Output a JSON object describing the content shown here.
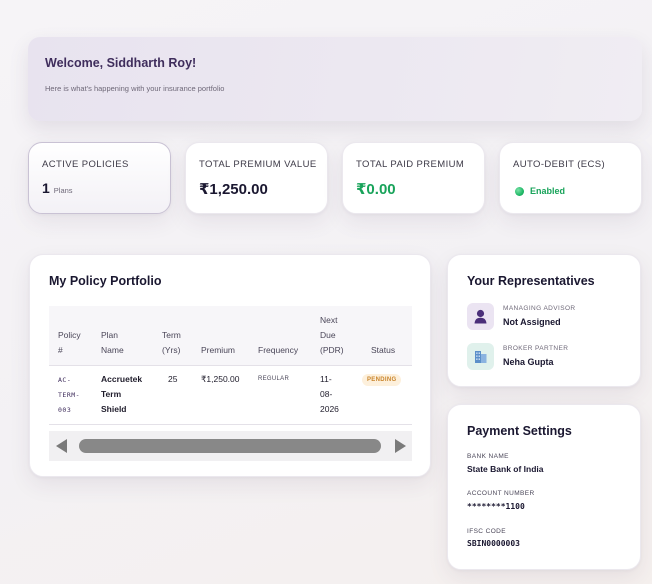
{
  "welcome": {
    "title": "Welcome, Siddharth Roy!",
    "subtitle": "Here is what's happening with your insurance portfolio"
  },
  "stats": {
    "active_policies": {
      "label": "ACTIVE POLICIES",
      "value": "1",
      "unit": "Plans"
    },
    "total_premium": {
      "label": "TOTAL PREMIUM VALUE",
      "value": "₹1,250.00"
    },
    "total_paid": {
      "label": "TOTAL PAID PREMIUM",
      "value": "₹0.00"
    },
    "auto_debit": {
      "label": "AUTO-DEBIT (ECS)",
      "status": "Enabled"
    }
  },
  "portfolio": {
    "title": "My Policy Portfolio",
    "columns": {
      "policy_no": [
        "Policy",
        "#"
      ],
      "plan_name": [
        "Plan",
        "Name"
      ],
      "term": [
        "Term",
        "(Yrs)"
      ],
      "premium": "Premium",
      "frequency": "Frequency",
      "next_due": [
        "Next",
        "Due",
        "(PDR)"
      ],
      "status": "Status"
    },
    "rows": [
      {
        "policy_no": [
          "AC-",
          "TERM-",
          "003"
        ],
        "plan_name": [
          "Accruetek",
          "Term",
          "Shield"
        ],
        "term": "25",
        "premium": "₹1,250.00",
        "frequency": "REGULAR",
        "next_due": [
          "11-",
          "08-",
          "2026"
        ],
        "status": "PENDING"
      }
    ]
  },
  "representatives": {
    "title": "Your Representatives",
    "items": [
      {
        "role": "MANAGING ADVISOR",
        "name": "Not Assigned",
        "icon": "person-icon"
      },
      {
        "role": "BROKER PARTNER",
        "name": "Neha Gupta",
        "icon": "building-icon"
      }
    ]
  },
  "payment": {
    "title": "Payment Settings",
    "bank_name_label": "BANK NAME",
    "bank_name": "State Bank of India",
    "account_label": "ACCOUNT NUMBER",
    "account": "********1100",
    "ifsc_label": "IFSC CODE",
    "ifsc": "SBIN0000003"
  },
  "colors": {
    "accent": "#3f2d5c",
    "success": "#18a35a",
    "pending_bg": "#fdf0dc",
    "pending_text": "#c9842a"
  }
}
